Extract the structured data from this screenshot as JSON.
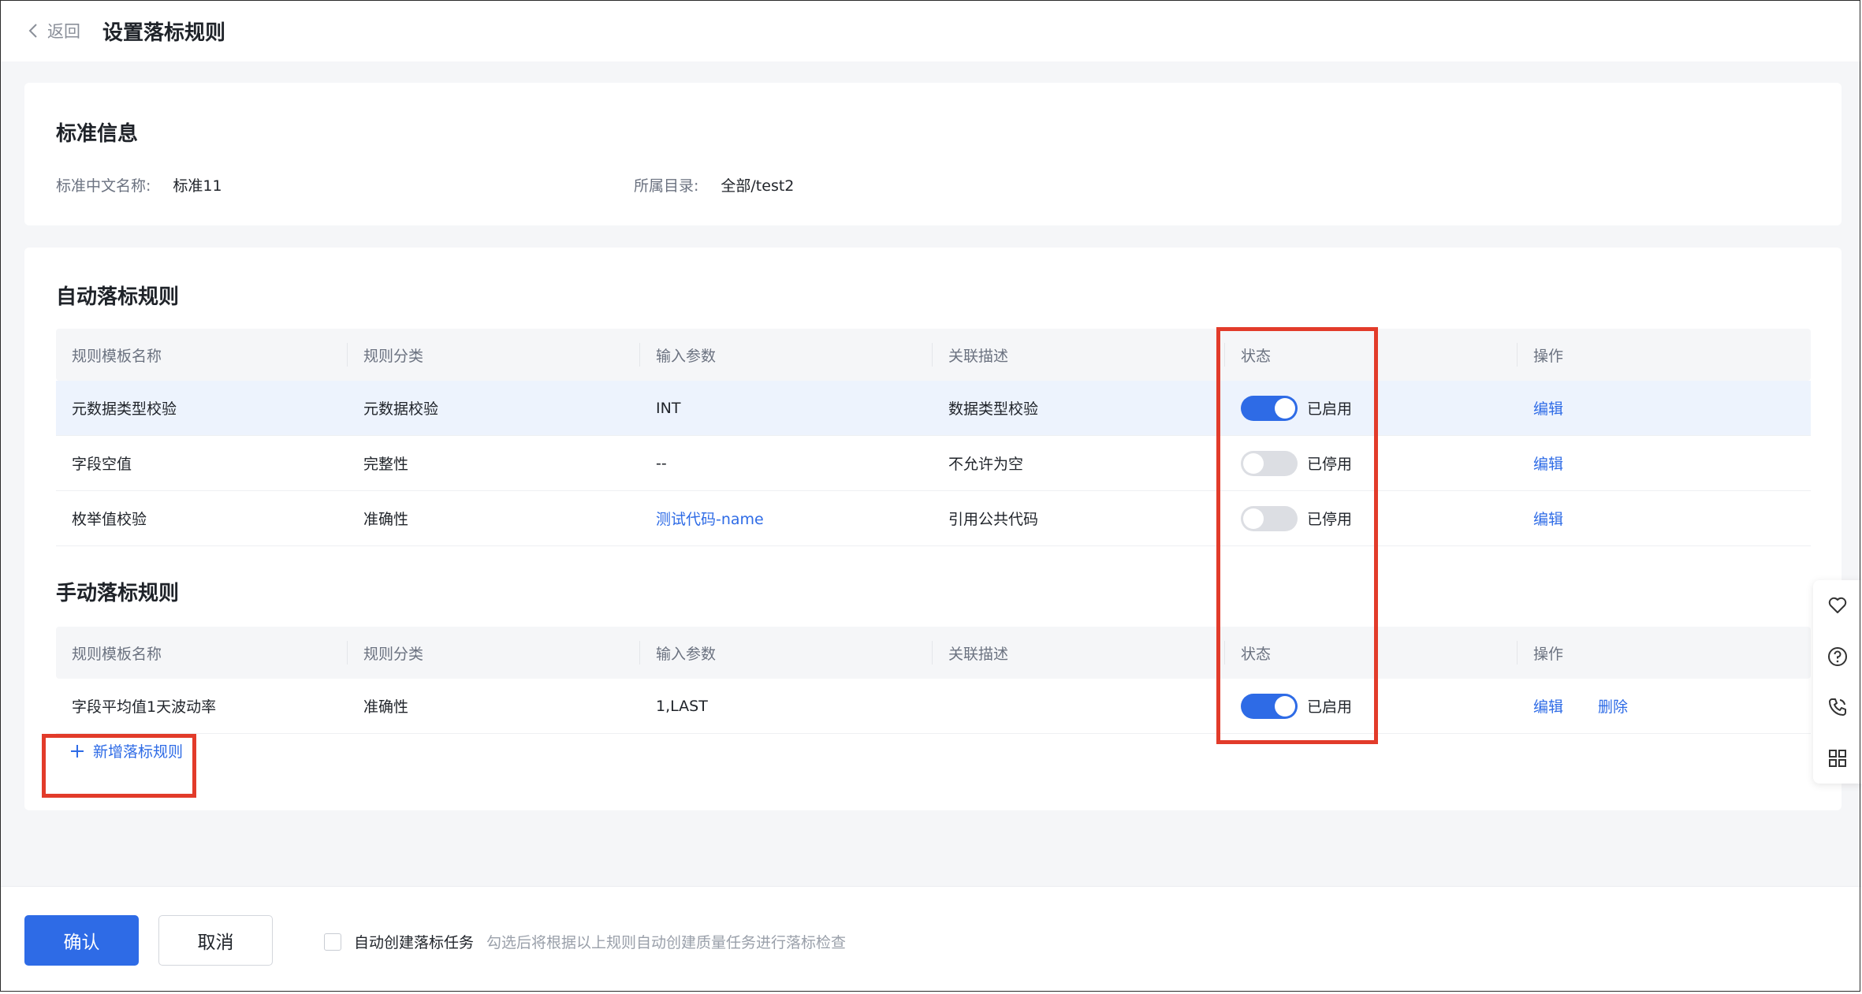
{
  "header": {
    "back_label": "返回",
    "title": "设置落标规则"
  },
  "standard_info": {
    "section_title": "标准信息",
    "chinese_name_label": "标准中文名称:",
    "chinese_name_value": "标准11",
    "directory_label": "所属目录:",
    "directory_value": "全部/test2"
  },
  "auto_rules": {
    "section_title": "自动落标规则",
    "columns": [
      "规则模板名称",
      "规则分类",
      "输入参数",
      "关联描述",
      "状态",
      "操作"
    ],
    "rows": [
      {
        "name": "元数据类型校验",
        "category": "元数据校验",
        "param": "INT",
        "description": "数据类型校验",
        "status": "已启用",
        "enabled": true,
        "action": "编辑"
      },
      {
        "name": "字段空值",
        "category": "完整性",
        "param": "--",
        "description": "不允许为空",
        "status": "已停用",
        "enabled": false,
        "action": "编辑"
      },
      {
        "name": "枚举值校验",
        "category": "准确性",
        "param": "测试代码-name",
        "description": "引用公共代码",
        "status": "已停用",
        "enabled": false,
        "action": "编辑"
      }
    ]
  },
  "manual_rules": {
    "section_title": "手动落标规则",
    "columns": [
      "规则模板名称",
      "规则分类",
      "输入参数",
      "关联描述",
      "状态",
      "操作"
    ],
    "rows": [
      {
        "name": "字段平均值1天波动率",
        "category": "准确性",
        "param": "1,LAST",
        "description": "",
        "status": "已启用",
        "enabled": true,
        "action_edit": "编辑",
        "action_delete": "删除"
      }
    ],
    "add_label": "新增落标规则"
  },
  "footer": {
    "confirm_label": "确认",
    "cancel_label": "取消",
    "auto_create_label": "自动创建落标任务",
    "auto_create_hint": "勾选后将根据以上规则自动创建质量任务进行落标检查",
    "auto_create_checked": false
  },
  "side_tools": [
    "heart-icon",
    "help-icon",
    "phone-icon",
    "grid-icon"
  ],
  "colors": {
    "accent": "#2e6be6",
    "highlight": "#e23b2a"
  }
}
